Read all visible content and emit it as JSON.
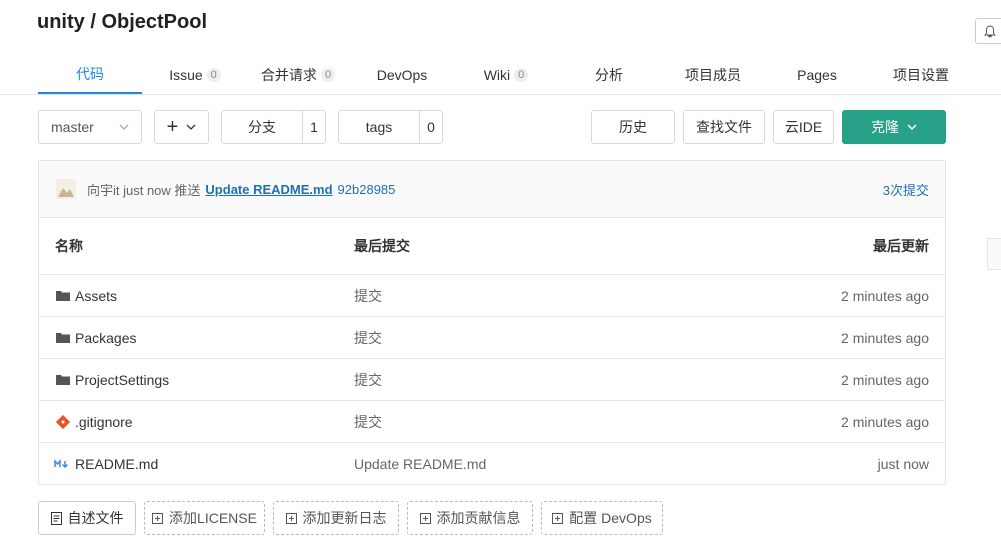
{
  "header": {
    "title": "unity / ObjectPool"
  },
  "tabs": [
    {
      "label": "代码"
    },
    {
      "label": "Issue",
      "count": "0"
    },
    {
      "label": "合并请求",
      "count": "0"
    },
    {
      "label": "DevOps"
    },
    {
      "label": "Wiki",
      "count": "0"
    },
    {
      "label": "分析"
    },
    {
      "label": "项目成员"
    },
    {
      "label": "Pages"
    },
    {
      "label": "项目设置"
    }
  ],
  "toolbar": {
    "branch_select": "master",
    "add_label": "+",
    "branches_label": "分支",
    "branches_count": "1",
    "tags_label": "tags",
    "tags_count": "0",
    "history_label": "历史",
    "find_file_label": "查找文件",
    "cloud_ide_label": "云IDE",
    "clone_label": "克隆"
  },
  "last_commit": {
    "author_action": "向宇it just now 推送",
    "message": "Update README.md",
    "sha": "92b28985",
    "commits_link": "3次提交"
  },
  "table": {
    "col_name": "名称",
    "col_commit": "最后提交",
    "col_updated": "最后更新",
    "rows": [
      {
        "name": "Assets",
        "icon": "folder-icon",
        "commit": "提交",
        "updated": "2 minutes ago"
      },
      {
        "name": "Packages",
        "icon": "folder-icon",
        "commit": "提交",
        "updated": "2 minutes ago"
      },
      {
        "name": "ProjectSettings",
        "icon": "folder-icon",
        "commit": "提交",
        "updated": "2 minutes ago"
      },
      {
        "name": ".gitignore",
        "icon": "git-file-icon",
        "commit": "提交",
        "updated": "2 minutes ago"
      },
      {
        "name": "README.md",
        "icon": "markdown-icon",
        "commit": "Update README.md",
        "updated": "just now"
      }
    ]
  },
  "footer_buttons": {
    "readme": "自述文件",
    "license": "添加LICENSE",
    "changelog": "添加更新日志",
    "contributing": "添加贡献信息",
    "devops": "配置 DevOps"
  },
  "colors": {
    "accent": "#1e88e5",
    "clone_bg": "#27a187",
    "link": "#1e6fb8"
  }
}
